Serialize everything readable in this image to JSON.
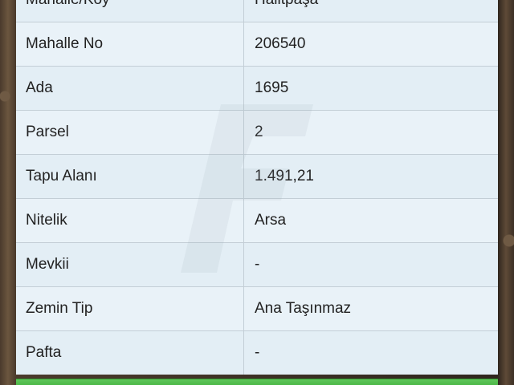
{
  "rows": [
    {
      "label": "Mahalle/Köy",
      "value": "Halitpaşa"
    },
    {
      "label": "Mahalle No",
      "value": "206540"
    },
    {
      "label": "Ada",
      "value": "1695"
    },
    {
      "label": "Parsel",
      "value": "2"
    },
    {
      "label": "Tapu Alanı",
      "value": "1.491,21"
    },
    {
      "label": "Nitelik",
      "value": "Arsa"
    },
    {
      "label": "Mevkii",
      "value": "-"
    },
    {
      "label": "Zemin Tip",
      "value": "Ana Taşınmaz"
    },
    {
      "label": "Pafta",
      "value": "-"
    }
  ],
  "colors": {
    "table_background": "#e8f1f6",
    "border": "#c3ced6",
    "text": "#222222",
    "bottom_bar": "#4cba46"
  }
}
